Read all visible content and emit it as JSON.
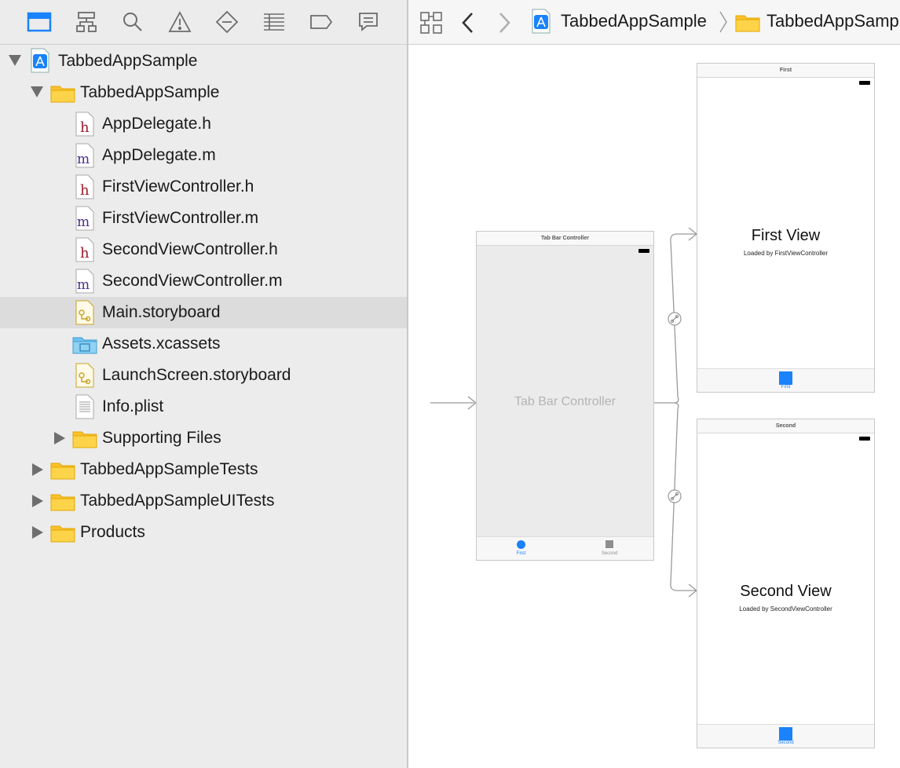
{
  "toolbar": {
    "icons": [
      "project-navigator-icon",
      "hierarchy-icon",
      "search-icon",
      "warning-icon",
      "test-icon",
      "debug-list-icon",
      "breakpoint-icon",
      "report-icon"
    ],
    "accent": "#1a82fb"
  },
  "tree": {
    "project_name": "TabbedAppSample",
    "group_name": "TabbedAppSample",
    "files": [
      {
        "name": "AppDelegate.h",
        "type": "h"
      },
      {
        "name": "AppDelegate.m",
        "type": "m"
      },
      {
        "name": "FirstViewController.h",
        "type": "h"
      },
      {
        "name": "FirstViewController.m",
        "type": "m"
      },
      {
        "name": "SecondViewController.h",
        "type": "h"
      },
      {
        "name": "SecondViewController.m",
        "type": "m"
      },
      {
        "name": "Main.storyboard",
        "type": "storyboard",
        "selected": true
      },
      {
        "name": "Assets.xcassets",
        "type": "xcassets"
      },
      {
        "name": "LaunchScreen.storyboard",
        "type": "storyboard"
      },
      {
        "name": "Info.plist",
        "type": "plist"
      }
    ],
    "supporting_files": "Supporting Files",
    "tests": "TabbedAppSampleTests",
    "ui_tests": "TabbedAppSampleUITests",
    "products": "Products"
  },
  "jumpbar": {
    "project": "TabbedAppSample",
    "folder": "TabbedAppSample"
  },
  "storyboard": {
    "tabbar_controller": {
      "title": "Tab Bar Controller",
      "center_label": "Tab Bar Controller",
      "tab1": "First",
      "tab2": "Second"
    },
    "first_scene": {
      "title": "First",
      "heading": "First View",
      "subtitle": "Loaded by FirstViewController",
      "tab": "First"
    },
    "second_scene": {
      "title": "Second",
      "heading": "Second View",
      "subtitle": "Loaded by SecondViewController",
      "tab": "Second"
    },
    "colors": {
      "tint": "#1a82fb",
      "gray": "#8e8e8e"
    }
  }
}
